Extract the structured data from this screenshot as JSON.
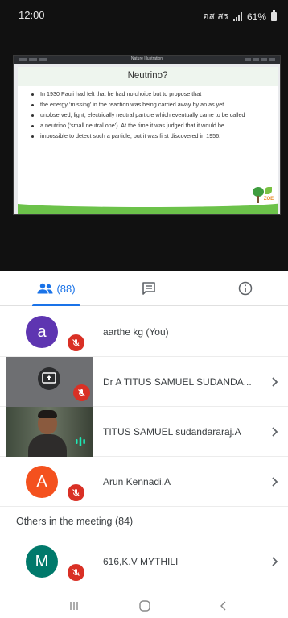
{
  "status_bar": {
    "time": "12:00",
    "indicators": "อส สร",
    "battery": "61%"
  },
  "presentation": {
    "window_title": "Nature Illustration",
    "slide_title": "Neutrino?",
    "bullets": [
      "In 1930 Pauli had felt that he had no choice but to propose that",
      "the energy ‘missing’ in the reaction was being carried away by an as yet",
      "unobserved, light, electrically neutral particle which eventually came to be called",
      "a neutrino (‘small neutral one’). At the time it was judged that it would be",
      "impossible to detect such a particle, but it was first discovered in 1956."
    ],
    "logo_text": "ZOE"
  },
  "tabs": {
    "people_count": "(88)",
    "people_icon": "people-icon",
    "chat_icon": "chat-icon",
    "info_icon": "info-icon"
  },
  "participants": [
    {
      "name": "aarthe kg (You)",
      "initial": "a",
      "color": "#5e35b1",
      "mic": "muted"
    },
    {
      "name": "Dr A TITUS SAMUEL SUDANDA...",
      "initial": "",
      "color": "#5f6368",
      "mic": "muted",
      "thumbnail": "presenting"
    },
    {
      "name": "TITUS SAMUEL sudandararaj.A",
      "initial": "",
      "color": "#3a4a3a",
      "mic": "speaking",
      "thumbnail": "camera"
    },
    {
      "name": "Arun Kennadi.A",
      "initial": "A",
      "color": "#f4511e",
      "mic": "muted"
    }
  ],
  "others_heading": "Others in the meeting (84)",
  "others": [
    {
      "name": "616,K.V MYTHILI",
      "initial": "M",
      "color": "#00796b",
      "mic": "muted"
    }
  ],
  "colors": {
    "accent": "#1a73e8",
    "muted_badge": "#d93025",
    "speaking": "#1de9b6"
  }
}
